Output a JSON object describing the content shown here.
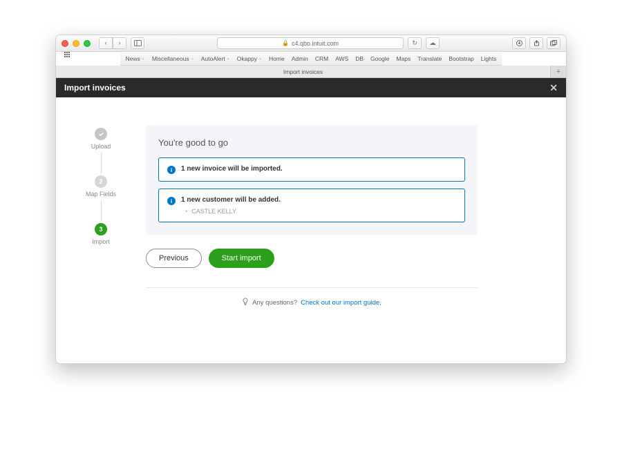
{
  "browser": {
    "url": "c4.qbo.intuit.com",
    "lock_label": "lock",
    "bookmarks": [
      {
        "label": "News",
        "dropdown": true
      },
      {
        "label": "Miscellaneous",
        "dropdown": true
      },
      {
        "label": "AutoAlert",
        "dropdown": true
      },
      {
        "label": "Okappy",
        "dropdown": true
      },
      {
        "label": "Home",
        "dropdown": false
      },
      {
        "label": "Admin",
        "dropdown": false
      },
      {
        "label": "CRM",
        "dropdown": false
      },
      {
        "label": "AWS",
        "dropdown": false
      },
      {
        "label": "DB",
        "dropdown": false
      },
      {
        "label": "Google",
        "dropdown": false
      },
      {
        "label": "Maps",
        "dropdown": false
      },
      {
        "label": "Translate",
        "dropdown": false
      },
      {
        "label": "Bootstrap",
        "dropdown": false
      },
      {
        "label": "Lights",
        "dropdown": false
      }
    ],
    "tab_title": "Import invoices"
  },
  "header": {
    "title": "Import invoices"
  },
  "stepper": {
    "step1_label": "Upload",
    "step2_num": "2",
    "step2_label": "Map Fields",
    "step3_num": "3",
    "step3_label": "Import"
  },
  "panel": {
    "title": "You're good to go",
    "info1": "1 new invoice will be imported.",
    "info2": "1 new customer will be added.",
    "customer1": "CASTLE KELLY"
  },
  "actions": {
    "previous": "Previous",
    "start": "Start import"
  },
  "help": {
    "question": "Any questions?",
    "link": "Check out our import guide."
  }
}
